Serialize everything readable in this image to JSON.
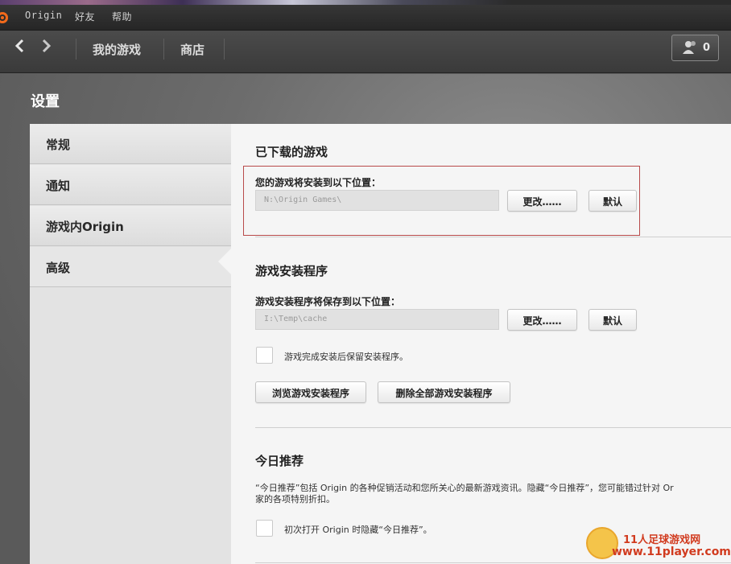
{
  "menubar": {
    "items": [
      "Origin",
      "好友",
      "帮助"
    ]
  },
  "navbar": {
    "back_icon": "chevron-left-icon",
    "forward_icon": "chevron-right-icon",
    "links": [
      "我的游戏",
      "商店"
    ],
    "friends_count": "0",
    "friends_icon": "people-icon"
  },
  "settings": {
    "title": "设置",
    "menu": [
      "常规",
      "通知",
      "游戏内Origin",
      "高级"
    ],
    "active_menu": "高级"
  },
  "downloaded": {
    "title": "已下载的游戏",
    "label": "您的游戏将安装到以下位置：",
    "path": "N:\\Origin Games\\",
    "change_button": "更改……",
    "default_button": "默认"
  },
  "installer": {
    "title": "游戏安装程序",
    "label": "游戏安装程序将保存到以下位置：",
    "path": "I:\\Temp\\cache",
    "change_button": "更改……",
    "default_button": "默认",
    "keep_checkbox_label": "游戏完成安装后保留安装程序。",
    "browse_button": "浏览游戏安装程序",
    "delete_button": "删除全部游戏安装程序"
  },
  "today": {
    "title": "今日推荐",
    "description_line1": "“今日推荐”包括 Origin 的各种促销活动和您所关心的最新游戏资讯。隐藏“今日推荐”，您可能错过针对 Or",
    "description_line2": "家的各项特别折扣。",
    "hide_checkbox_label": "初次打开 Origin 时隐藏“今日推荐”。"
  },
  "watermark": {
    "line1": "11人足球游戏网",
    "line2": "www.11player.com"
  },
  "colors": {
    "highlight_border": "#b84a4a",
    "origin_orange": "#f26a1b"
  }
}
